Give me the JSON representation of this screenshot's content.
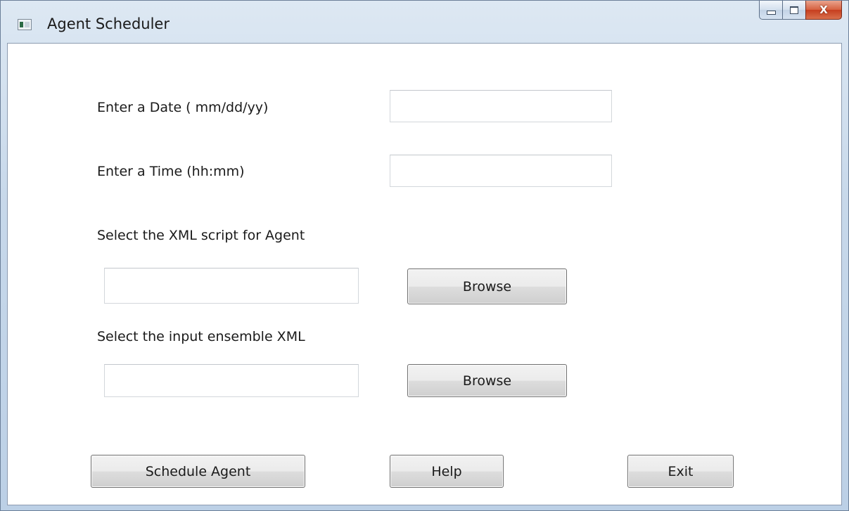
{
  "window": {
    "title": "Agent Scheduler"
  },
  "caption_buttons": {
    "minimize_icon": "minimize-icon",
    "maximize_icon": "maximize-icon",
    "close_glyph": "X"
  },
  "form": {
    "date_label": "Enter a Date ( mm/dd/yy)",
    "date_value": "",
    "time_label": "Enter a Time (hh:mm)",
    "time_value": "",
    "script_label": "Select the XML script for Agent",
    "script_value": "",
    "script_browse_label": "Browse",
    "ensemble_label": "Select the input ensemble XML",
    "ensemble_value": "",
    "ensemble_browse_label": "Browse"
  },
  "actions": {
    "schedule_label": "Schedule Agent",
    "help_label": "Help",
    "exit_label": "Exit"
  }
}
